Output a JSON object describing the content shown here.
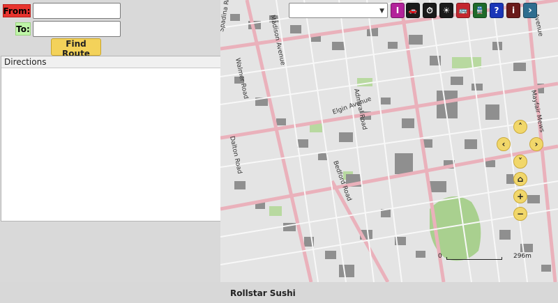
{
  "route_form": {
    "from_label": "From:",
    "to_label": "To:",
    "from_value": "",
    "to_value": "",
    "find_route_label": "Find Route"
  },
  "directions": {
    "header": "Directions"
  },
  "toolbar": {
    "buttons": [
      {
        "name": "text-cursor",
        "glyph": "I",
        "color": "#b3229a"
      },
      {
        "name": "car",
        "glyph": "🚗",
        "color": "#1a1a1a"
      },
      {
        "name": "clock",
        "glyph": "⏱",
        "color": "#1a1a1a"
      },
      {
        "name": "sun",
        "glyph": "☀",
        "color": "#1a1a1a"
      },
      {
        "name": "bus",
        "glyph": "🚌",
        "color": "#c4262e"
      },
      {
        "name": "train",
        "glyph": "🚆",
        "color": "#1f6b2a"
      },
      {
        "name": "help",
        "glyph": "?",
        "color": "#1a36b8"
      },
      {
        "name": "info",
        "glyph": "i",
        "color": "#6a1a1a"
      },
      {
        "name": "expand",
        "glyph": "›",
        "color": "#2f6d8f"
      }
    ]
  },
  "map": {
    "street_labels": [
      "Spadina Road",
      "Madison Avenue",
      "Walmer Road",
      "Elgin Avenue",
      "Admiral Road",
      "Dalton Road",
      "Bedford Road",
      "Mayfair Mews",
      "Avenue"
    ],
    "scale_start": "0",
    "scale_end": "296m"
  },
  "status": {
    "text": "Rollstar Sushi"
  }
}
